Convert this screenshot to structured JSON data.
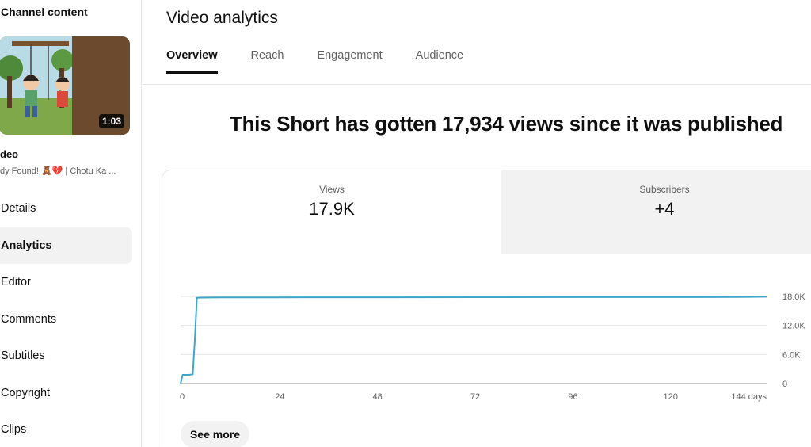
{
  "sidebar": {
    "title": "Channel content",
    "thumbnail": {
      "duration": "1:03"
    },
    "video_title": "deo",
    "video_subtitle": "dy Found! 🧸💔 | Chotu Ka ...",
    "items": [
      {
        "label": "Details"
      },
      {
        "label": "Analytics",
        "active": true
      },
      {
        "label": "Editor"
      },
      {
        "label": "Comments"
      },
      {
        "label": "Subtitles"
      },
      {
        "label": "Copyright"
      },
      {
        "label": "Clips"
      }
    ]
  },
  "main": {
    "title": "Video analytics",
    "tabs": [
      {
        "label": "Overview",
        "active": true
      },
      {
        "label": "Reach"
      },
      {
        "label": "Engagement"
      },
      {
        "label": "Audience"
      }
    ],
    "headline": "This Short has gotten 17,934 views since it was published",
    "metrics": {
      "views": {
        "label": "Views",
        "value": "17.9K"
      },
      "subscribers": {
        "label": "Subscribers",
        "value": "+4"
      }
    },
    "see_more_label": "See more"
  },
  "colors": {
    "line": "#3ea6c9",
    "grid": "#e5e5e5",
    "axis_text": "#606060"
  },
  "chart_data": {
    "type": "line",
    "xlabel": "",
    "ylabel": "",
    "x_ticks": [
      "0",
      "24",
      "48",
      "72",
      "96",
      "120",
      "144 days"
    ],
    "y_ticks": [
      "0",
      "6.0K",
      "12.0K",
      "18.0K"
    ],
    "xlim": [
      0,
      144
    ],
    "ylim": [
      0,
      18000
    ],
    "series": [
      {
        "x": [
          0,
          0.5,
          1,
          2,
          3,
          3.5,
          4,
          5,
          10,
          24,
          48,
          72,
          96,
          120,
          136,
          140,
          144
        ],
        "y": [
          0,
          1800,
          1800,
          1800,
          1900,
          9000,
          17700,
          17750,
          17780,
          17800,
          17820,
          17840,
          17850,
          17860,
          17870,
          17900,
          17934
        ]
      }
    ]
  }
}
